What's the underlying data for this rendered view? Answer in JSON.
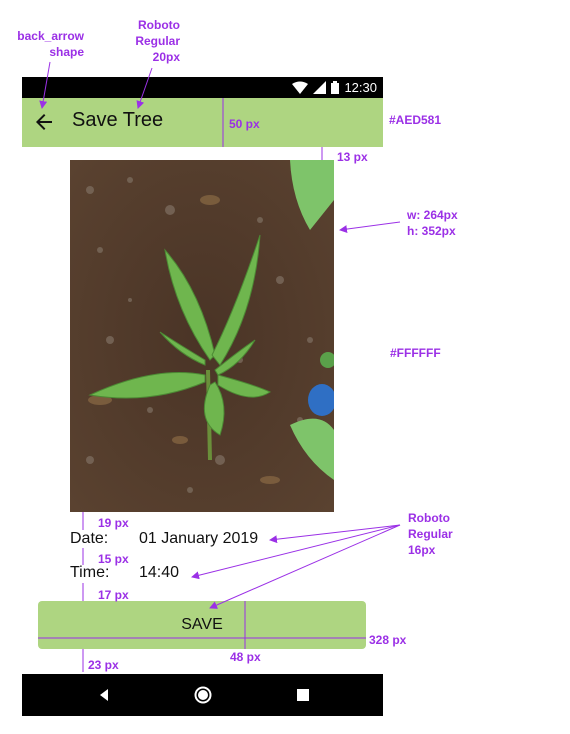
{
  "annotations": {
    "back_arrow": [
      "back_arrow",
      "shape"
    ],
    "title_font": [
      "Roboto",
      "Regular",
      "20px"
    ],
    "appbar_height": "50 px",
    "appbar_color": "#AED581",
    "gap_13": "13 px",
    "image_size": [
      "w: 264px",
      "h: 352px"
    ],
    "bg_color": "#FFFFFF",
    "gap_19": "19 px",
    "gap_15": "15 px",
    "gap_17": "17 px",
    "body_font": [
      "Roboto",
      "Regular",
      "16px"
    ],
    "button_width": "328 px",
    "button_height": "48 px",
    "gap_23": "23 px"
  },
  "status_bar": {
    "time": "12:30"
  },
  "app_bar": {
    "title": "Save Tree",
    "background": "#AED581"
  },
  "details": {
    "date_label": "Date:",
    "date_value": "01 January 2019",
    "time_label": "Time:",
    "time_value": "14:40"
  },
  "save_button": {
    "label": "SAVE"
  },
  "colors": {
    "annotation": "#9B30E6",
    "background": "#FFFFFF",
    "accent": "#AED581"
  },
  "icons": [
    "back-arrow-icon",
    "wifi-icon",
    "signal-icon",
    "battery-icon",
    "nav-back-icon",
    "nav-home-icon",
    "nav-recents-icon"
  ]
}
